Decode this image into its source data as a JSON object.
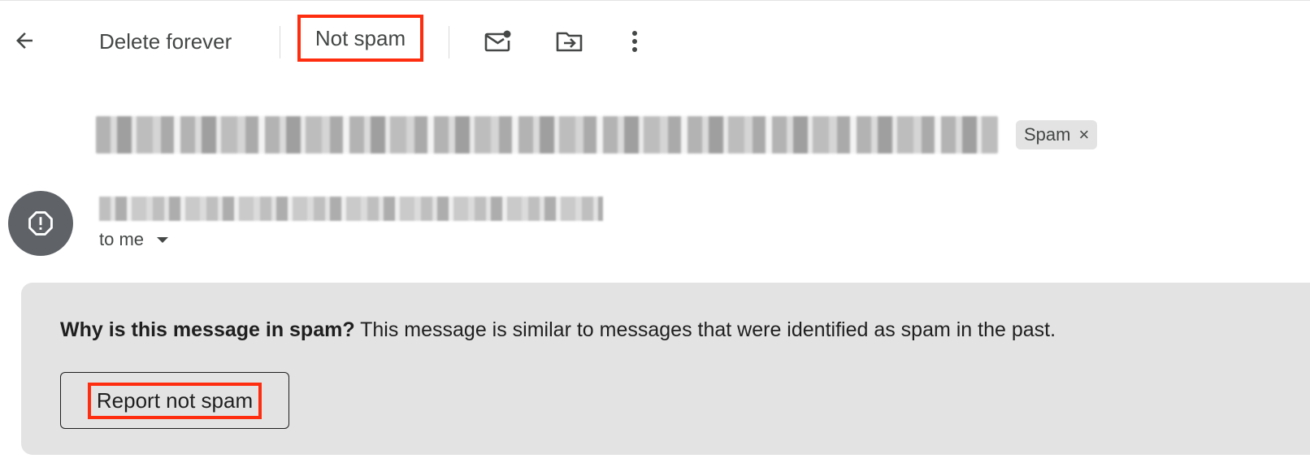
{
  "toolbar": {
    "back_icon": "arrow-back-icon",
    "delete_forever_label": "Delete forever",
    "not_spam_label": "Not spam",
    "mark_unread_icon": "mark-unread-icon",
    "move_to_icon": "move-to-folder-icon",
    "more_icon": "more-vert-icon",
    "highlight_color": "#ff2d10"
  },
  "message": {
    "label_chip": "Spam",
    "label_chip_remove": "×",
    "recipient_label": "to me",
    "avatar_icon": "spam-warning-icon"
  },
  "spam_banner": {
    "question": "Why is this message in spam?",
    "explanation": " This message is similar to messages that were identified as spam in the past.",
    "report_button_label": "Report not spam"
  }
}
